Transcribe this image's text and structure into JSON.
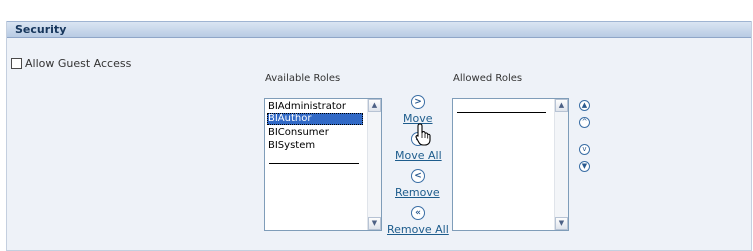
{
  "section": {
    "title": "Security"
  },
  "guest_access": {
    "label": "Allow Guest Access",
    "checked": false
  },
  "available_roles": {
    "label": "Available Roles",
    "options": [
      "BIAdministrator",
      "BIAuthor",
      "BIConsumer",
      "BISystem"
    ],
    "selected": "BIAuthor"
  },
  "allowed_roles": {
    "label": "Allowed Roles",
    "options": []
  },
  "shuttle": {
    "move": {
      "label": "Move",
      "icon": "move-right-icon"
    },
    "move_all": {
      "label": "Move All",
      "icon": "move-all-right-icon"
    },
    "remove": {
      "label": "Remove",
      "icon": "remove-left-icon"
    },
    "remove_all": {
      "label": "Remove All",
      "icon": "remove-all-left-icon"
    }
  },
  "reorder": {
    "icons": [
      "move-top-icon",
      "move-up-icon",
      "move-down-icon",
      "move-bottom-icon"
    ]
  },
  "colors": {
    "header_gradient_top": "#dae5f3",
    "header_gradient_bottom": "#b8cbe4",
    "panel_background": "#eef2f8",
    "selection": "#3169c6",
    "link": "#1d5c8c"
  }
}
